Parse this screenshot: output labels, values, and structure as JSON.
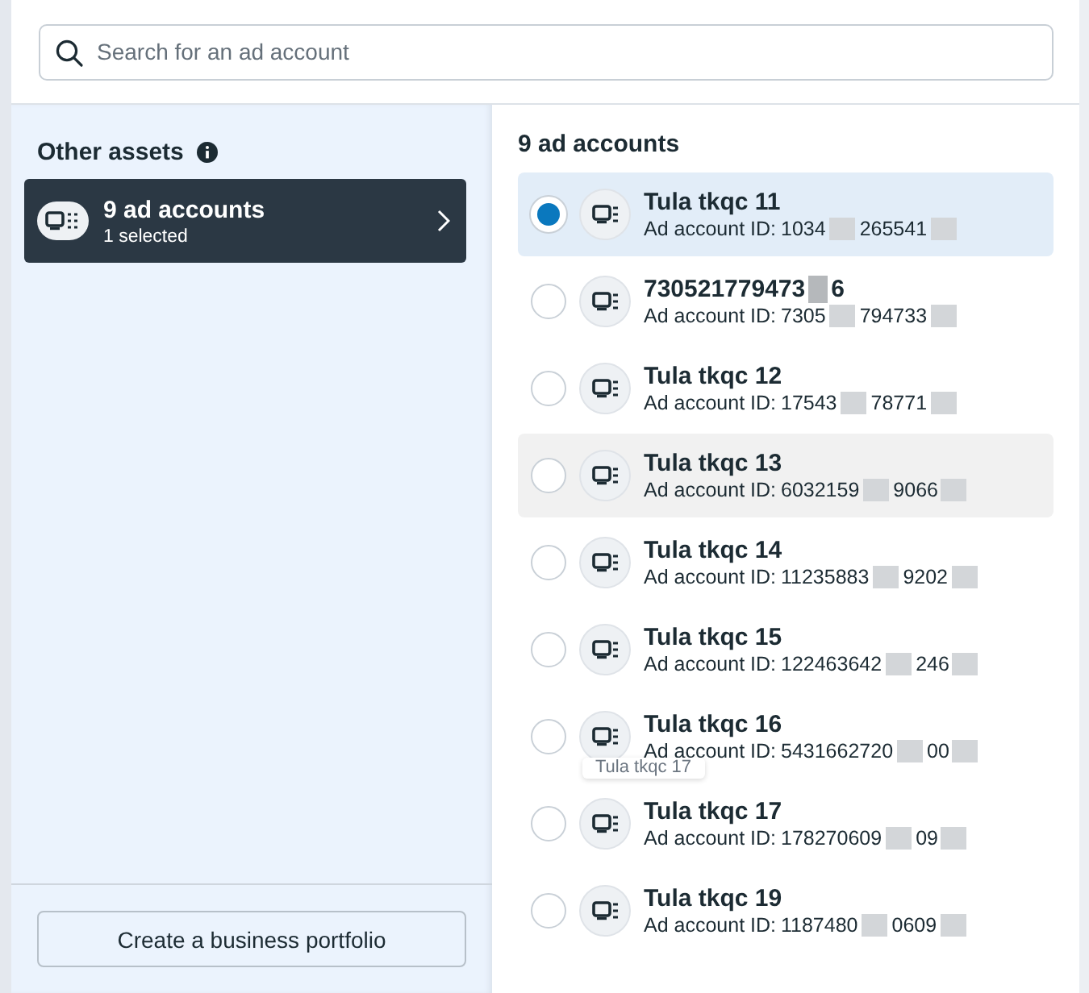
{
  "search": {
    "placeholder": "Search for an ad account"
  },
  "sidebar": {
    "heading": "Other assets",
    "asset": {
      "title": "9 ad accounts",
      "subtitle": "1 selected",
      "selected": true
    },
    "footer_button": "Create a business portfolio"
  },
  "list": {
    "heading": "9 ad accounts",
    "accounts": [
      {
        "name": [
          "Tula tkqc 11"
        ],
        "id_label": "Ad account ID:",
        "id": [
          "1034",
          "265541"
        ],
        "selected": true,
        "hovered": false
      },
      {
        "name": [
          "730521779473",
          "6"
        ],
        "id_label": "Ad account ID:",
        "id": [
          "7305",
          "794733"
        ],
        "selected": false,
        "hovered": false
      },
      {
        "name": [
          "Tula tkqc 12"
        ],
        "id_label": "Ad account ID:",
        "id": [
          "17543",
          "78771"
        ],
        "selected": false,
        "hovered": false
      },
      {
        "name": [
          "Tula tkqc 13"
        ],
        "id_label": "Ad account ID:",
        "id": [
          "6032159",
          "9066"
        ],
        "selected": false,
        "hovered": true
      },
      {
        "name": [
          "Tula tkqc 14"
        ],
        "id_label": "Ad account ID:",
        "id": [
          "11235883",
          "9202"
        ],
        "selected": false,
        "hovered": false
      },
      {
        "name": [
          "Tula tkqc 15"
        ],
        "id_label": "Ad account ID:",
        "id": [
          "122463642",
          "246"
        ],
        "selected": false,
        "hovered": false
      },
      {
        "name": [
          "Tula tkqc 16"
        ],
        "id_label": "Ad account ID:",
        "id": [
          "5431662720",
          "00"
        ],
        "selected": false,
        "hovered": false,
        "drag_preview": "Tula tkqc 17"
      },
      {
        "name": [
          "Tula tkqc 17"
        ],
        "id_label": "Ad account ID:",
        "id": [
          "178270609",
          "09"
        ],
        "selected": false,
        "hovered": false
      },
      {
        "name": [
          "Tula tkqc 19"
        ],
        "id_label": "Ad account ID:",
        "id": [
          "1187480",
          "0609"
        ],
        "selected": false,
        "hovered": false
      }
    ]
  }
}
